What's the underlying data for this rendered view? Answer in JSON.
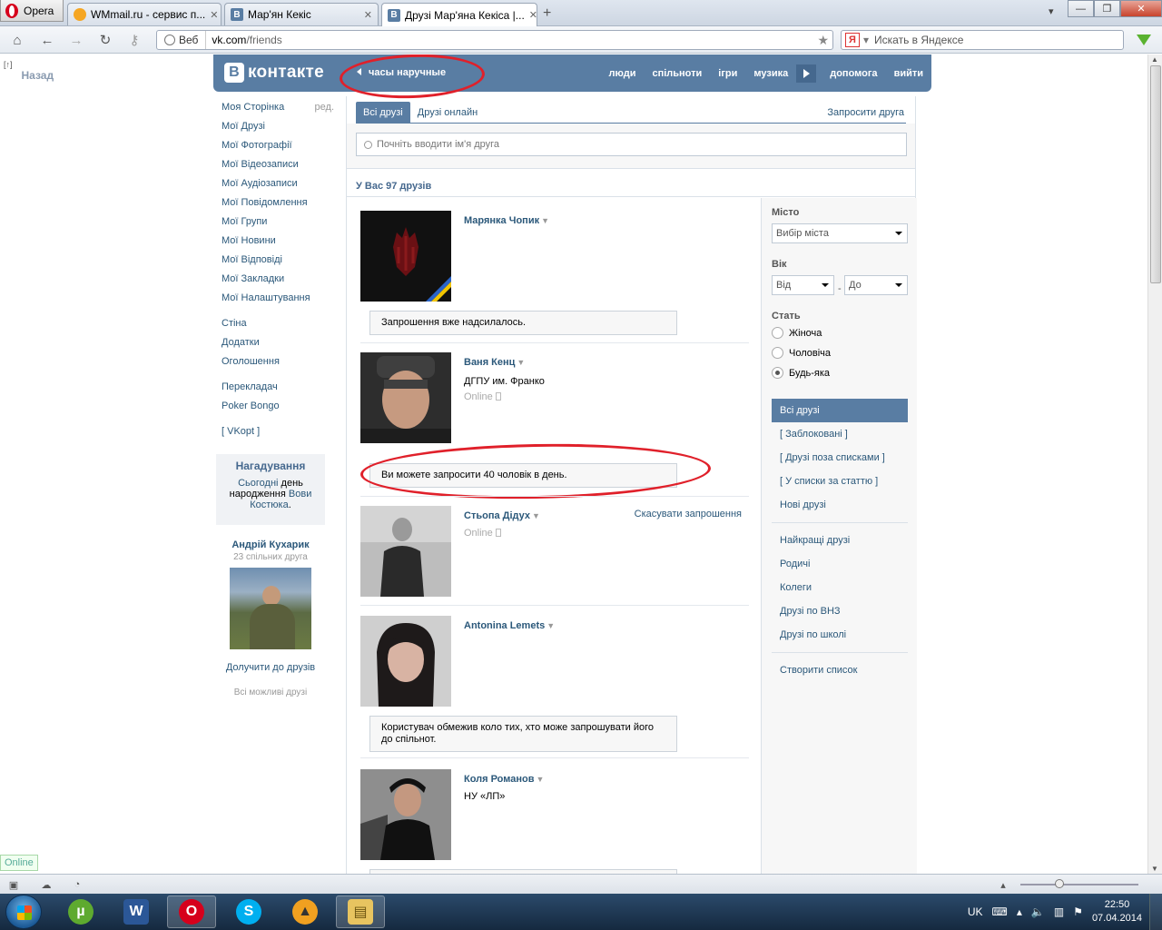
{
  "browser": {
    "app_button": "Opera",
    "tabs": [
      {
        "title": "WMmail.ru - сервис п..."
      },
      {
        "title": "Мар'ян Кекіс"
      },
      {
        "title": "Друзі Мар'яна Кекіса |..."
      }
    ],
    "address_label": "Веб",
    "url_host": "vk.com",
    "url_path": "/friends",
    "search_placeholder": "Искать в Яндексе",
    "yandex_letter": "Я"
  },
  "page": {
    "back_label": "Назад",
    "back_shortcut": "[↑]",
    "logo_text": "контакте",
    "logo_letter": "B",
    "status_text": "часы наручные",
    "top_menu": [
      "люди",
      "спільноти",
      "ігри",
      "музика",
      "допомога",
      "вийти"
    ],
    "left_nav": {
      "edit_label": "ред.",
      "group1": [
        "Моя Сторінка",
        "Мої Друзі",
        "Мої Фотографії",
        "Мої Відеозаписи",
        "Мої Аудіозаписи",
        "Мої Повідомлення",
        "Мої Групи",
        "Мої Новини",
        "Мої Відповіді",
        "Мої Закладки",
        "Мої Налаштування"
      ],
      "group2": [
        "Стіна",
        "Додатки",
        "Оголошення"
      ],
      "group3": [
        "Перекладач",
        "Poker Bongo"
      ],
      "group4": [
        "[ VKopt ]"
      ]
    },
    "reminder": {
      "title": "Нагадування",
      "today": "Сьогодні",
      "text1": " день народження ",
      "person": "Вови Костюка",
      "end": "."
    },
    "suggestion": {
      "name": "Андрій Кухарик",
      "common": "23 спільних друга",
      "add": "Долучити до друзів",
      "all": "Всі можливі друзі"
    },
    "friends_tabs": [
      "Всі друзі",
      "Друзі онлайн"
    ],
    "invite_friend": "Запросити друга",
    "search_friend_placeholder": "Почніть вводити ім'я друга",
    "friend_count": "У Вас 97 друзів",
    "friends": [
      {
        "name": "Марянка Чопик",
        "message": "Запрошення вже надсилалось."
      },
      {
        "name": "Ваня Кенц",
        "info": "ДГПУ им. Франко",
        "online": "Online",
        "message": "Ви можете запросити 40 чоловік в день."
      },
      {
        "name": "Стьопа Дідух",
        "online": "Online",
        "action": "Скасувати запрошення"
      },
      {
        "name": "Antonina Lemets",
        "message": "Користувач обмежив коло тих, хто може запрошувати його до спільнот."
      },
      {
        "name": "Коля Романов",
        "info": "НУ «ЛП»"
      }
    ],
    "filters": {
      "city_label": "Місто",
      "city_value": "Вибір міста",
      "age_label": "Вік",
      "age_from": "Від",
      "age_to": "До",
      "age_sep": "-",
      "sex_label": "Стать",
      "sex_options": [
        "Жіноча",
        "Чоловіча",
        "Будь-яка"
      ],
      "sex_selected": "Будь-яка",
      "lists1": [
        "Всі друзі",
        "[ Заблоковані ]",
        "[ Друзі поза списками ]",
        "[ У списки за статтю ]",
        "Нові друзі"
      ],
      "lists2": [
        "Найкращі друзі",
        "Родичі",
        "Колеги",
        "Друзі по ВНЗ",
        "Друзі по школі"
      ],
      "create_list": "Створити список"
    },
    "online_badge": "Online"
  },
  "taskbar": {
    "lang": "UK",
    "time": "22:50",
    "date": "07.04.2014"
  },
  "colors": {
    "vk_blue": "#597da3",
    "vk_link": "#2b587a",
    "annotation_red": "#e0202a"
  }
}
